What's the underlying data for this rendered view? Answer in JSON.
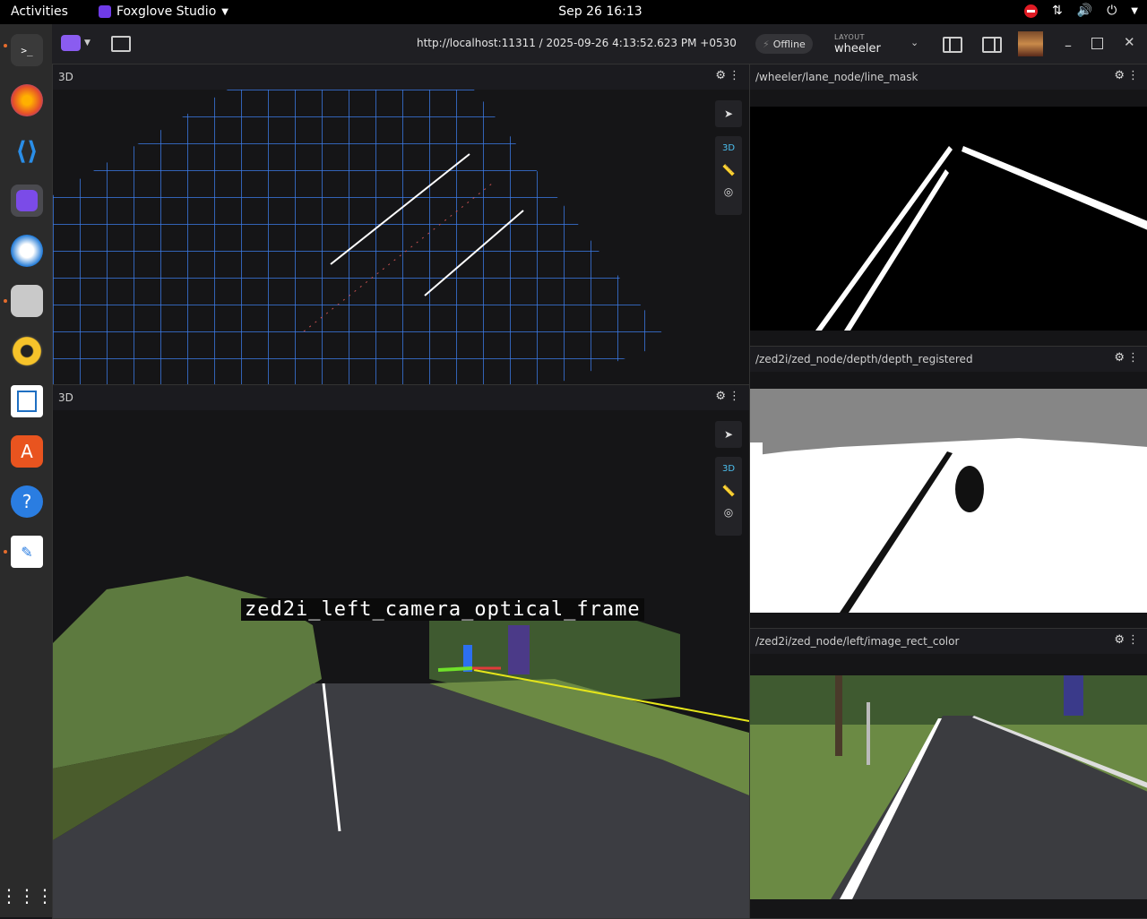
{
  "topbar": {
    "activities": "Activities",
    "app_name": "Foxglove Studio",
    "clock": "Sep 26  16:13"
  },
  "toolbar": {
    "url": "http://localhost:11311 / 2025-09-26 4:13:52.623 PM +0530",
    "status": "Offline",
    "layout_label": "LAYOUT",
    "layout_value": "wheeler"
  },
  "panels": {
    "top_3d": {
      "title": "3D"
    },
    "bottom_3d": {
      "title": "3D",
      "frame_label": "zed2i_left_camera_optical_frame"
    },
    "line_mask": {
      "title": "/wheeler/lane_node/line_mask"
    },
    "depth": {
      "title": "/zed2i/zed_node/depth/depth_registered"
    },
    "image": {
      "title": "/zed2i/zed_node/left/image_rect_color"
    },
    "tools": {
      "mode": "3D"
    }
  }
}
